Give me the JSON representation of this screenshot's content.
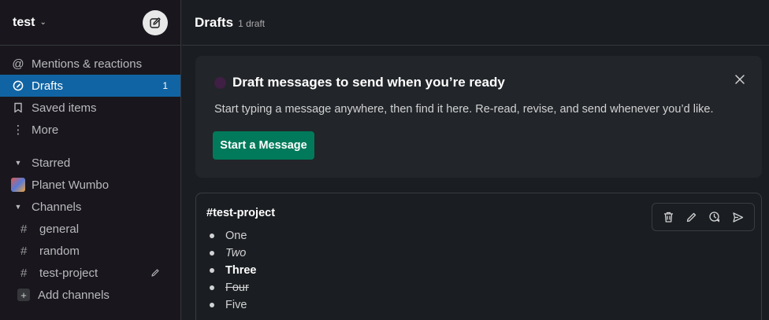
{
  "workspace": {
    "name": "test"
  },
  "nav": {
    "mentions": "Mentions & reactions",
    "drafts": "Drafts",
    "drafts_count": "1",
    "saved": "Saved items",
    "more": "More"
  },
  "starred": {
    "label": "Starred",
    "items": [
      {
        "label": "Planet Wumbo"
      }
    ]
  },
  "channels": {
    "label": "Channels",
    "items": [
      {
        "label": "general"
      },
      {
        "label": "random"
      },
      {
        "label": "test-project"
      }
    ],
    "add_label": "Add channels"
  },
  "header": {
    "title": "Drafts",
    "subtitle": "1 draft"
  },
  "banner": {
    "title": "Draft messages to send when you’re ready",
    "text": "Start typing a message anywhere, then find it here. Re-read, revise, and send whenever you’d like.",
    "button": "Start a Message"
  },
  "draft": {
    "channel": "#test-project",
    "items": [
      "One",
      "Two",
      "Three",
      "Four",
      "Five"
    ]
  },
  "colors": {
    "sidebar_bg": "#19171d",
    "active": "#1164a3",
    "button": "#007a5a",
    "main_bg": "#1a1d21"
  }
}
